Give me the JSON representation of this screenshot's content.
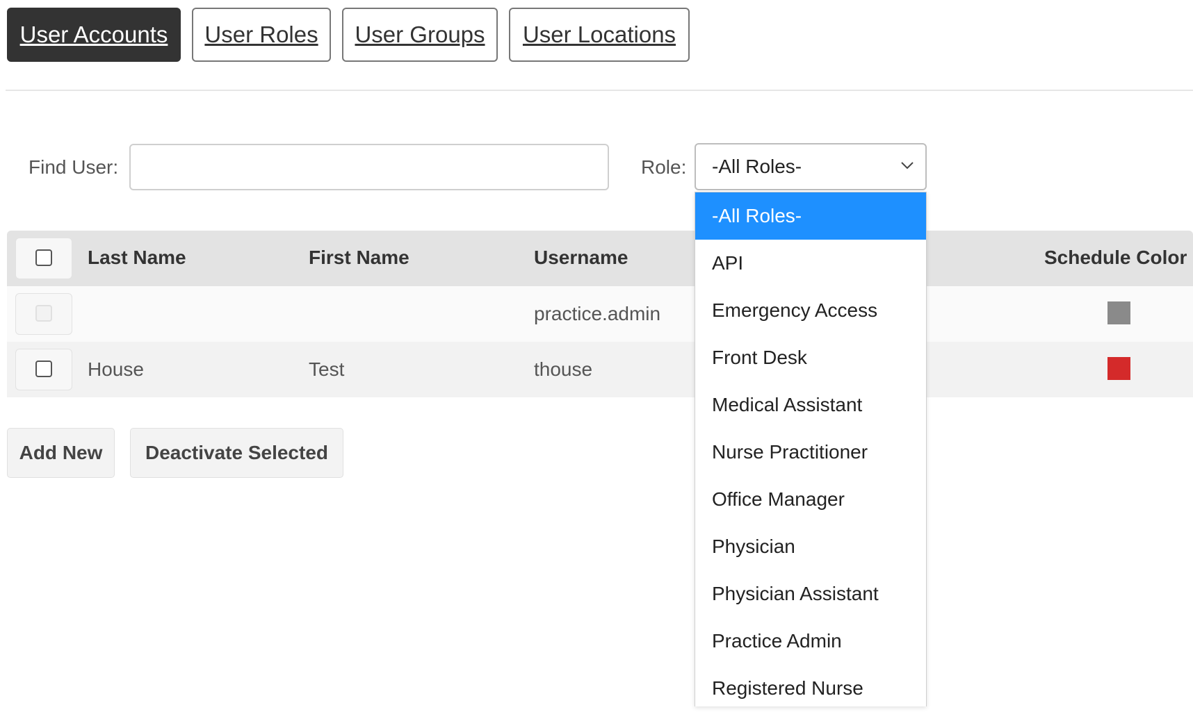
{
  "tabs": [
    {
      "label": "User Accounts",
      "active": true
    },
    {
      "label": "User Roles",
      "active": false
    },
    {
      "label": "User Groups",
      "active": false
    },
    {
      "label": "User Locations",
      "active": false
    }
  ],
  "filters": {
    "find_user_label": "Find User:",
    "find_user_value": "",
    "role_label": "Role:",
    "role_selected": "-All Roles-"
  },
  "table": {
    "headers": {
      "last_name": "Last Name",
      "first_name": "First Name",
      "username": "Username",
      "schedule_color": "Schedule Color"
    },
    "rows": [
      {
        "last_name": "",
        "first_name": "",
        "username": "practice.admin",
        "schedule_color": "#8a8a8a",
        "checkbox_disabled": true
      },
      {
        "last_name": "House",
        "first_name": "Test",
        "username": "thouse",
        "schedule_color": "#d42a2a",
        "checkbox_disabled": false
      }
    ]
  },
  "actions": {
    "add_new": "Add New",
    "deactivate_selected": "Deactivate Selected"
  },
  "role_dropdown": {
    "options": [
      "-All Roles-",
      "API",
      "Emergency Access",
      "Front Desk",
      "Medical Assistant",
      "Nurse Practitioner",
      "Office Manager",
      "Physician",
      "Physician Assistant",
      "Practice Admin",
      "Registered Nurse"
    ],
    "highlighted": "-All Roles-",
    "highlight_color": "#1e90ff"
  }
}
